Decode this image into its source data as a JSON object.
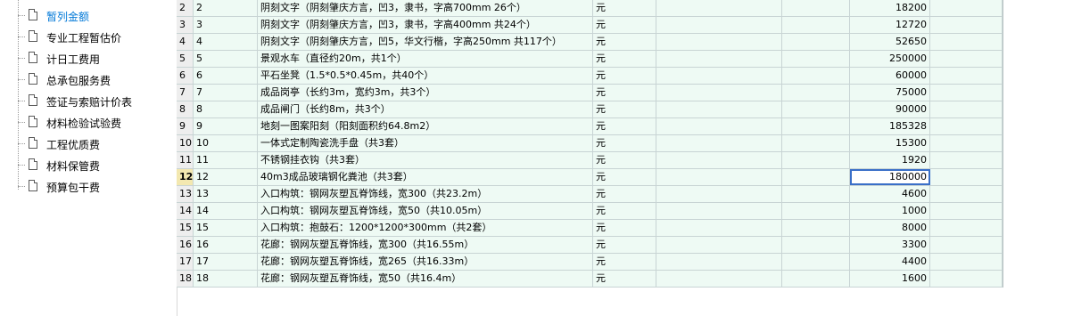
{
  "sidebar": {
    "items": [
      {
        "label": "暂列金额",
        "selected": true
      },
      {
        "label": "专业工程暂估价",
        "selected": false
      },
      {
        "label": "计日工费用",
        "selected": false
      },
      {
        "label": "总承包服务费",
        "selected": false
      },
      {
        "label": "签证与索赔计价表",
        "selected": false
      },
      {
        "label": "材料检验试验费",
        "selected": false
      },
      {
        "label": "工程优质费",
        "selected": false
      },
      {
        "label": "材料保管费",
        "selected": false
      },
      {
        "label": "预算包干费",
        "selected": false
      }
    ]
  },
  "table": {
    "current_row": "12",
    "rows": [
      {
        "no": "2",
        "code": "2",
        "name": "阴刻文字（阴刻肇庆方言，凹3，隶书，字高700mm 26个）",
        "unit": "元",
        "amount": "18200"
      },
      {
        "no": "3",
        "code": "3",
        "name": "阴刻文字（阴刻肇庆方言，凹3，隶书，字高400mm 共24个）",
        "unit": "元",
        "amount": "12720"
      },
      {
        "no": "4",
        "code": "4",
        "name": "阴刻文字（阴刻肇庆方言，凹5，华文行楷，字高250mm 共117个）",
        "unit": "元",
        "amount": "52650"
      },
      {
        "no": "5",
        "code": "5",
        "name": "景观水车（直径约20m，共1个）",
        "unit": "元",
        "amount": "250000"
      },
      {
        "no": "6",
        "code": "6",
        "name": "平石坐凳（1.5*0.5*0.45m，共40个）",
        "unit": "元",
        "amount": "60000"
      },
      {
        "no": "7",
        "code": "7",
        "name": "成品岗亭（长约3m，宽约3m，共3个）",
        "unit": "元",
        "amount": "75000"
      },
      {
        "no": "8",
        "code": "8",
        "name": "成品闸门（长约8m，共3个）",
        "unit": "元",
        "amount": "90000"
      },
      {
        "no": "9",
        "code": "9",
        "name": "地刻一图案阳刻（阳刻面积约64.8m2）",
        "unit": "元",
        "amount": "185328"
      },
      {
        "no": "10",
        "code": "10",
        "name": "一体式定制陶瓷洗手盘（共3套）",
        "unit": "元",
        "amount": "15300"
      },
      {
        "no": "11",
        "code": "11",
        "name": "不锈钢挂衣钩（共3套）",
        "unit": "元",
        "amount": "1920"
      },
      {
        "no": "12",
        "code": "12",
        "name": "40m3成品玻璃钢化粪池（共3套）",
        "unit": "元",
        "amount": "180000"
      },
      {
        "no": "13",
        "code": "13",
        "name": "入口构筑：钢网灰塑瓦脊饰线，宽300（共23.2m）",
        "unit": "元",
        "amount": "4600"
      },
      {
        "no": "14",
        "code": "14",
        "name": "入口构筑：钢网灰塑瓦脊饰线，宽50（共10.05m）",
        "unit": "元",
        "amount": "1000"
      },
      {
        "no": "15",
        "code": "15",
        "name": "入口构筑：抱鼓石：1200*1200*300mm（共2套）",
        "unit": "元",
        "amount": "8000"
      },
      {
        "no": "16",
        "code": "16",
        "name": "花廊：钢网灰塑瓦脊饰线，宽300（共16.55m）",
        "unit": "元",
        "amount": "3300"
      },
      {
        "no": "17",
        "code": "17",
        "name": "花廊：钢网灰塑瓦脊饰线，宽265（共16.33m）",
        "unit": "元",
        "amount": "4400"
      },
      {
        "no": "18",
        "code": "18",
        "name": "花廊：钢网灰塑瓦脊饰线，宽50（共16.4m）",
        "unit": "元",
        "amount": "1600"
      }
    ]
  }
}
